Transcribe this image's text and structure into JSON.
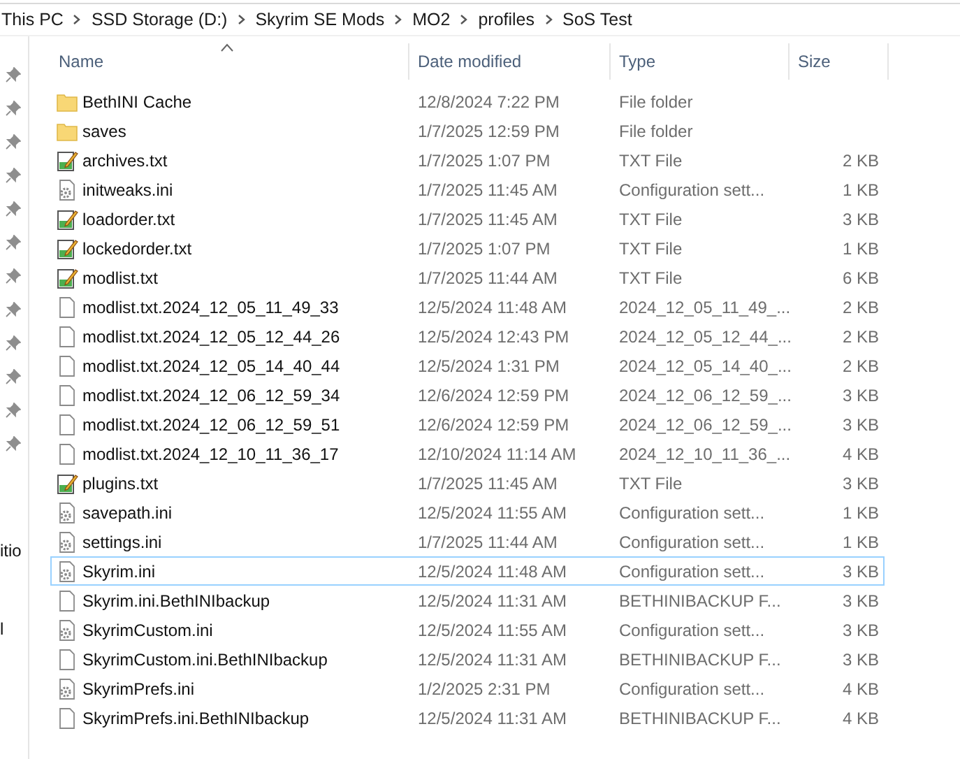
{
  "breadcrumb": [
    "This PC",
    "SSD Storage (D:)",
    "Skyrim SE Mods",
    "MO2",
    "profiles",
    "SoS Test"
  ],
  "nav_pane": {
    "texts": [
      "itio",
      "l"
    ]
  },
  "columns": [
    {
      "label": "Name",
      "sorted": true
    },
    {
      "label": "Date modified",
      "sorted": false
    },
    {
      "label": "Type",
      "sorted": false
    },
    {
      "label": "Size",
      "sorted": false
    }
  ],
  "rows": [
    {
      "kind": "folder",
      "name": "BethINI Cache",
      "date": "12/8/2024 7:22 PM",
      "type": "File folder",
      "focused": false
    },
    {
      "kind": "folder",
      "name": "saves",
      "date": "1/7/2025 12:59 PM",
      "type": "File folder",
      "focused": false
    },
    {
      "kind": "text",
      "name": "archives.txt",
      "date": "1/7/2025 1:07 PM",
      "type": "TXT File",
      "size": "2 KB",
      "focused": false
    },
    {
      "kind": "config",
      "name": "initweaks.ini",
      "date": "1/7/2025 11:45 AM",
      "type": "Configuration sett...",
      "size": "1 KB",
      "focused": false
    },
    {
      "kind": "text",
      "name": "loadorder.txt",
      "date": "1/7/2025 11:45 AM",
      "type": "TXT File",
      "size": "3 KB",
      "focused": false
    },
    {
      "kind": "text",
      "name": "lockedorder.txt",
      "date": "1/7/2025 1:07 PM",
      "type": "TXT File",
      "size": "1 KB",
      "focused": false
    },
    {
      "kind": "text",
      "name": "modlist.txt",
      "date": "1/7/2025 11:44 AM",
      "type": "TXT File",
      "size": "6 KB",
      "focused": false
    },
    {
      "kind": "file",
      "name": "modlist.txt.2024_12_05_11_49_33",
      "date": "12/5/2024 11:48 AM",
      "type": "2024_12_05_11_49_...",
      "size": "2 KB",
      "focused": false
    },
    {
      "kind": "file",
      "name": "modlist.txt.2024_12_05_12_44_26",
      "date": "12/5/2024 12:43 PM",
      "type": "2024_12_05_12_44_...",
      "size": "2 KB",
      "focused": false
    },
    {
      "kind": "file",
      "name": "modlist.txt.2024_12_05_14_40_44",
      "date": "12/5/2024 1:31 PM",
      "type": "2024_12_05_14_40_...",
      "size": "2 KB",
      "focused": false
    },
    {
      "kind": "file",
      "name": "modlist.txt.2024_12_06_12_59_34",
      "date": "12/6/2024 12:59 PM",
      "type": "2024_12_06_12_59_...",
      "size": "3 KB",
      "focused": false
    },
    {
      "kind": "file",
      "name": "modlist.txt.2024_12_06_12_59_51",
      "date": "12/6/2024 12:59 PM",
      "type": "2024_12_06_12_59_...",
      "size": "3 KB",
      "focused": false
    },
    {
      "kind": "file",
      "name": "modlist.txt.2024_12_10_11_36_17",
      "date": "12/10/2024 11:14 AM",
      "type": "2024_12_10_11_36_...",
      "size": "4 KB",
      "focused": false
    },
    {
      "kind": "text",
      "name": "plugins.txt",
      "date": "1/7/2025 11:45 AM",
      "type": "TXT File",
      "size": "3 KB",
      "focused": false
    },
    {
      "kind": "config",
      "name": "savepath.ini",
      "date": "12/5/2024 11:55 AM",
      "type": "Configuration sett...",
      "size": "1 KB",
      "focused": false
    },
    {
      "kind": "config",
      "name": "settings.ini",
      "date": "1/7/2025 11:44 AM",
      "type": "Configuration sett...",
      "size": "1 KB",
      "focused": false
    },
    {
      "kind": "config",
      "name": "Skyrim.ini",
      "date": "12/5/2024 11:48 AM",
      "type": "Configuration sett...",
      "size": "3 KB",
      "focused": true
    },
    {
      "kind": "file",
      "name": "Skyrim.ini.BethINIbackup",
      "date": "12/5/2024 11:31 AM",
      "type": "BETHINIBACKUP F...",
      "size": "3 KB",
      "focused": false
    },
    {
      "kind": "config",
      "name": "SkyrimCustom.ini",
      "date": "12/5/2024 11:55 AM",
      "type": "Configuration sett...",
      "size": "3 KB",
      "focused": false
    },
    {
      "kind": "file",
      "name": "SkyrimCustom.ini.BethINIbackup",
      "date": "12/5/2024 11:31 AM",
      "type": "BETHINIBACKUP F...",
      "size": "3 KB",
      "focused": false
    },
    {
      "kind": "config",
      "name": "SkyrimPrefs.ini",
      "date": "1/2/2025 2:31 PM",
      "type": "Configuration sett...",
      "size": "4 KB",
      "focused": false
    },
    {
      "kind": "file",
      "name": "SkyrimPrefs.ini.BethINIbackup",
      "date": "12/5/2024 11:31 AM",
      "type": "BETHINIBACKUP F...",
      "size": "4 KB",
      "focused": false
    }
  ]
}
